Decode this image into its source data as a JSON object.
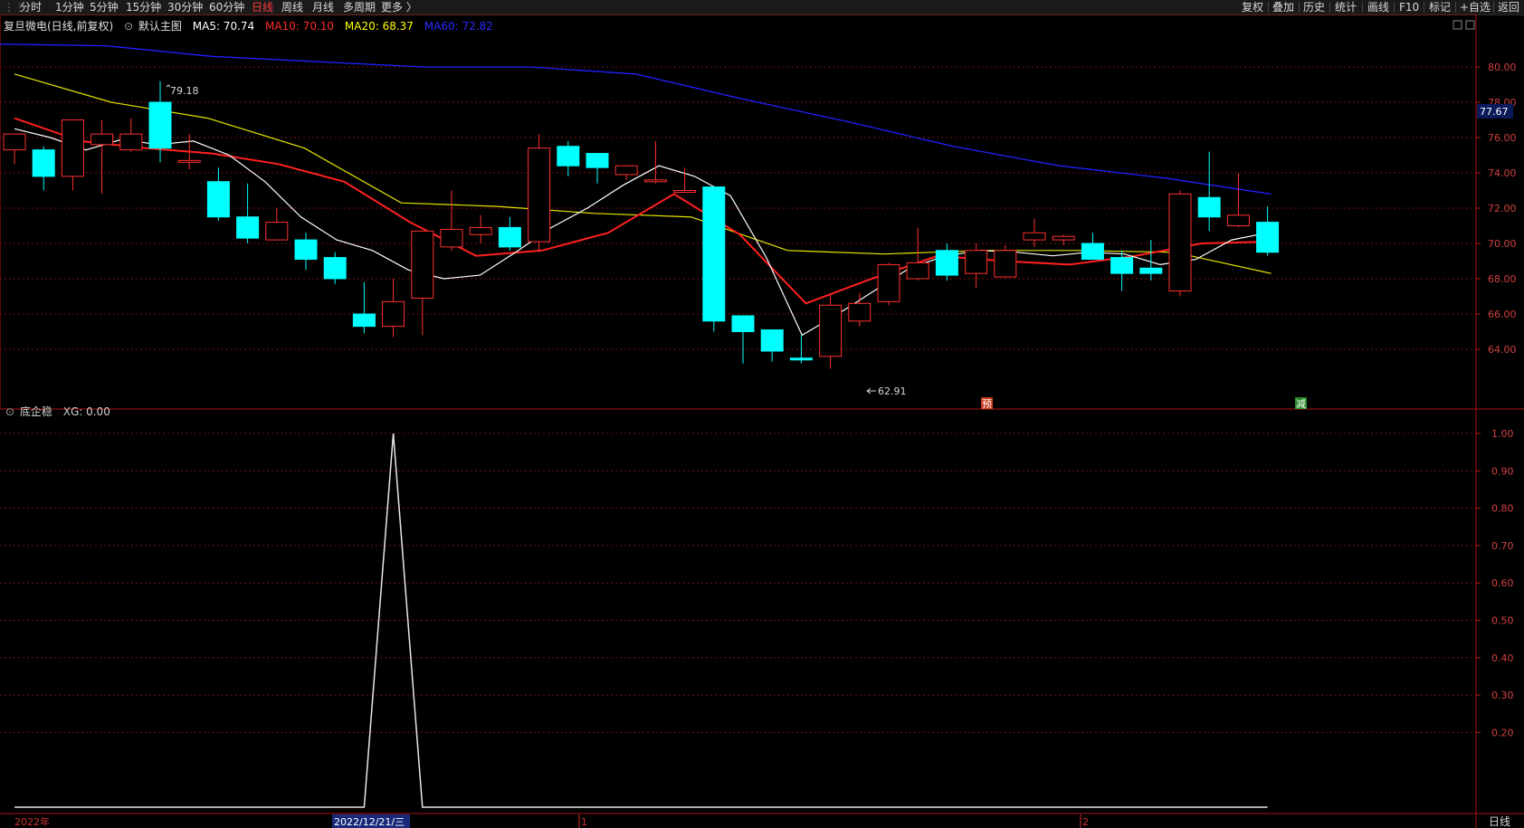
{
  "toolbar": {
    "tabs": [
      "分时",
      "1分钟",
      "5分钟",
      "15分钟",
      "30分钟",
      "60分钟",
      "日线",
      "周线",
      "月线",
      "多周期",
      "更多 〉"
    ],
    "active_tab": "日线",
    "right_buttons": [
      "复权",
      "叠加",
      "历史",
      "统计",
      "画线",
      "F10",
      "标记",
      "+自选",
      "返回"
    ]
  },
  "main_panel": {
    "title": "复旦微电(日线,前复权)",
    "mode": "默认主图",
    "ma_labels": [
      {
        "text": "MA5: 70.74",
        "color": "#ffffff"
      },
      {
        "text": "MA10: 70.10",
        "color": "#ff2a2a"
      },
      {
        "text": "MA20: 68.37",
        "color": "#ffff00"
      },
      {
        "text": "MA60: 72.82",
        "color": "#2a2aff"
      }
    ],
    "current_price_tag": "77.67",
    "high_annotation": "79.18",
    "low_annotation": "62.91",
    "marker_pre": "预",
    "marker_reduce": "减"
  },
  "indicator_panel": {
    "title": "底企稳",
    "value_label": "XG: 0.00"
  },
  "bottom_axis": {
    "labels": [
      "2022年",
      "2022/12/21/三",
      "1",
      "2"
    ],
    "period_label": "日线"
  },
  "colors": {
    "up": "#ff3030",
    "down": "#00ffff",
    "ma5": "#ffffff",
    "ma10": "#ff2020",
    "ma20": "#e6e600",
    "ma60": "#2020ff",
    "grid": "#7a1010",
    "axis": "#c01818"
  },
  "chart_data": [
    {
      "type": "candlestick",
      "title": "复旦微电(日线,前复权)",
      "ylim": [
        63,
        81
      ],
      "y_ticks": [
        "80.00",
        "78.00",
        "76.00",
        "74.00",
        "72.00",
        "70.00",
        "68.00",
        "66.00",
        "64.00"
      ],
      "candles": [
        {
          "o": 75.3,
          "h": 75.9,
          "l": 74.5,
          "c": 76.2
        },
        {
          "o": 75.3,
          "h": 75.5,
          "l": 73.0,
          "c": 73.8
        },
        {
          "o": 73.8,
          "h": 77.0,
          "l": 73.0,
          "c": 77.0
        },
        {
          "o": 75.6,
          "h": 77.0,
          "l": 72.8,
          "c": 76.2
        },
        {
          "o": 75.3,
          "h": 77.1,
          "l": 75.2,
          "c": 76.2
        },
        {
          "o": 78.0,
          "h": 79.2,
          "l": 74.6,
          "c": 75.4
        },
        {
          "o": 74.7,
          "h": 76.2,
          "l": 74.2,
          "c": 74.7
        },
        {
          "o": 73.5,
          "h": 74.3,
          "l": 71.3,
          "c": 71.5
        },
        {
          "o": 71.5,
          "h": 73.4,
          "l": 70.0,
          "c": 70.3
        },
        {
          "o": 70.2,
          "h": 72.0,
          "l": 70.2,
          "c": 71.2
        },
        {
          "o": 70.2,
          "h": 70.6,
          "l": 68.5,
          "c": 69.1
        },
        {
          "o": 69.2,
          "h": 69.5,
          "l": 67.7,
          "c": 68.0
        },
        {
          "o": 66.0,
          "h": 67.8,
          "l": 64.9,
          "c": 65.3
        },
        {
          "o": 65.3,
          "h": 68.0,
          "l": 64.7,
          "c": 66.7
        },
        {
          "o": 66.9,
          "h": 70.7,
          "l": 64.8,
          "c": 70.7
        },
        {
          "o": 69.8,
          "h": 73.0,
          "l": 69.6,
          "c": 70.8
        },
        {
          "o": 70.5,
          "h": 71.6,
          "l": 70.0,
          "c": 70.9
        },
        {
          "o": 70.9,
          "h": 71.5,
          "l": 69.6,
          "c": 69.8
        },
        {
          "o": 70.1,
          "h": 76.2,
          "l": 69.5,
          "c": 75.4
        },
        {
          "o": 75.5,
          "h": 75.8,
          "l": 73.8,
          "c": 74.4
        },
        {
          "o": 75.1,
          "h": 75.1,
          "l": 73.4,
          "c": 74.3
        },
        {
          "o": 73.9,
          "h": 74.4,
          "l": 73.6,
          "c": 74.4
        },
        {
          "o": 73.5,
          "h": 75.8,
          "l": 73.4,
          "c": 73.6
        },
        {
          "o": 73.0,
          "h": 74.3,
          "l": 72.9,
          "c": 73.0
        },
        {
          "o": 73.2,
          "h": 73.2,
          "l": 65.0,
          "c": 65.6
        },
        {
          "o": 65.9,
          "h": 65.9,
          "l": 63.2,
          "c": 65.0
        },
        {
          "o": 65.1,
          "h": 65.1,
          "l": 63.3,
          "c": 63.9
        },
        {
          "o": 63.5,
          "h": 64.8,
          "l": 63.2,
          "c": 63.4
        },
        {
          "o": 63.6,
          "h": 67.1,
          "l": 62.9,
          "c": 66.5
        },
        {
          "o": 65.6,
          "h": 67.2,
          "l": 65.3,
          "c": 66.6
        },
        {
          "o": 66.7,
          "h": 68.9,
          "l": 66.5,
          "c": 68.8
        },
        {
          "o": 68.0,
          "h": 70.9,
          "l": 67.9,
          "c": 68.9
        },
        {
          "o": 69.6,
          "h": 70.0,
          "l": 67.9,
          "c": 68.2
        },
        {
          "o": 68.3,
          "h": 70.0,
          "l": 67.5,
          "c": 69.6
        },
        {
          "o": 68.1,
          "h": 69.9,
          "l": 68.1,
          "c": 69.6
        },
        {
          "o": 70.2,
          "h": 71.4,
          "l": 69.8,
          "c": 70.6
        },
        {
          "o": 70.2,
          "h": 70.5,
          "l": 69.9,
          "c": 70.4
        },
        {
          "o": 70.0,
          "h": 70.6,
          "l": 69.5,
          "c": 69.1
        },
        {
          "o": 69.2,
          "h": 69.6,
          "l": 67.3,
          "c": 68.3
        },
        {
          "o": 68.6,
          "h": 70.2,
          "l": 67.9,
          "c": 68.3
        },
        {
          "o": 67.3,
          "h": 73.0,
          "l": 67.0,
          "c": 72.8
        },
        {
          "o": 72.6,
          "h": 75.2,
          "l": 70.7,
          "c": 71.5
        },
        {
          "o": 71.0,
          "h": 74.0,
          "l": 70.9,
          "c": 71.6
        },
        {
          "o": 71.2,
          "h": 72.1,
          "l": 69.3,
          "c": 69.5
        }
      ],
      "ma5": [
        76.5,
        76.0,
        75.3,
        75.9,
        75.6,
        75.8,
        75.0,
        73.5,
        71.5,
        70.2,
        69.6,
        68.5,
        68.0,
        68.2,
        69.5,
        70.9,
        72.0,
        73.3,
        74.4,
        73.8,
        72.7,
        69.2,
        64.8,
        66.0,
        67.3,
        68.6,
        69.3,
        69.6,
        69.5,
        69.3,
        69.5,
        69.4,
        68.8,
        69.1,
        70.2,
        70.6
      ],
      "ma10": [
        77.1,
        75.8,
        75.4,
        75.1,
        74.5,
        73.5,
        71.2,
        69.3,
        69.6,
        70.6,
        72.8,
        70.5,
        66.6,
        68.0,
        69.3,
        69.0,
        68.8,
        69.3,
        70.0,
        70.1
      ],
      "ma20": [
        79.6,
        78.0,
        77.1,
        75.4,
        72.3,
        72.1,
        71.7,
        71.5,
        69.6,
        69.4,
        69.6,
        69.6,
        69.5,
        68.3
      ],
      "ma60": [
        81.3,
        81.2,
        80.6,
        80.3,
        80.0,
        80.0,
        79.6,
        78.2,
        76.9,
        75.5,
        74.4,
        73.7,
        72.8
      ]
    },
    {
      "type": "line",
      "title": "底企稳",
      "series": [
        {
          "name": "XG",
          "values": [
            0,
            0,
            0,
            0,
            0,
            0,
            0,
            0,
            0,
            0,
            0,
            0,
            0,
            1,
            0,
            0,
            0,
            0,
            0,
            0,
            0,
            0,
            0,
            0,
            0,
            0,
            0,
            0,
            0,
            0,
            0,
            0,
            0,
            0,
            0,
            0,
            0,
            0,
            0,
            0,
            0,
            0,
            0,
            0
          ]
        }
      ],
      "ylim": [
        0,
        1.05
      ],
      "y_ticks": [
        "1.00",
        "0.90",
        "0.80",
        "0.70",
        "0.60",
        "0.50",
        "0.40",
        "0.30",
        "0.20"
      ]
    }
  ]
}
